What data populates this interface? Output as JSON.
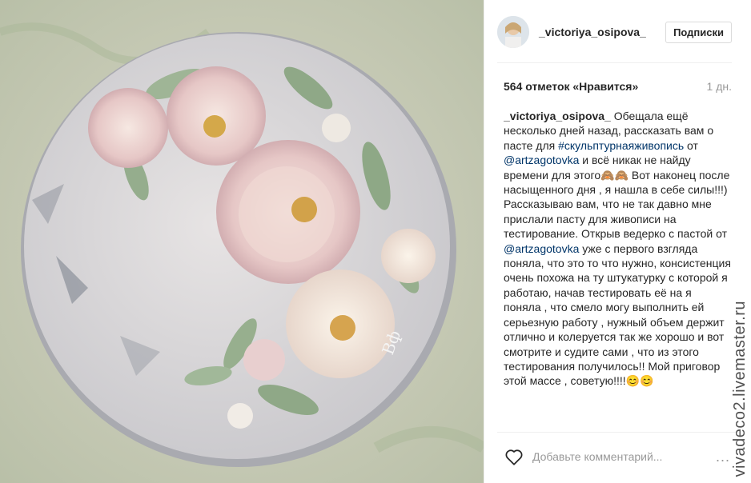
{
  "header": {
    "username": "_victoriya_osipova_",
    "follow_label": "Подписки"
  },
  "stats": {
    "likes": "564 отметок «Нравится»",
    "time": "1 дн."
  },
  "caption": {
    "username": "_victoriya_osipova_",
    "part1": " Обещала ещё несколько дней назад, рассказать вам о пасте для ",
    "hashtag": "#скульптурнаяживопись",
    "part2": " от ",
    "mention1": "@artzagotovka",
    "part3": " и всё никак не найду времени для этого",
    "emoji1": "🙈🙈",
    "part4": " Вот наконец после насыщенного дня , я нашла в себе силы!!!)",
    "para2_a": "Рассказываю вам, что не так давно мне прислали пасту для живописи на тестирование. Открыв ведерко с пастой от ",
    "mention2": "@artzagotovka",
    "para2_b": " уже с первого взгляда поняла, что это то что нужно, консистенция очень похожа на ту штукатурку с которой я работаю, начав тестировать её на я поняла , что смело могу выполнить ей серьезную работу , нужный объем держит отлично и колеруется так же хорошо и вот смотрите и судите сами , что из этого тестирования получилось!! Мой приговор этой массе , советую!!!!",
    "emoji2": "😊😊"
  },
  "comment": {
    "placeholder": "Добавьте комментарий...",
    "more": "..."
  },
  "watermark": "vivadeco2.livemaster.ru",
  "icons": {
    "heart": "heart-icon",
    "more": "more-icon"
  },
  "colors": {
    "border": "#efefef",
    "link": "#003569",
    "muted": "#999999"
  }
}
